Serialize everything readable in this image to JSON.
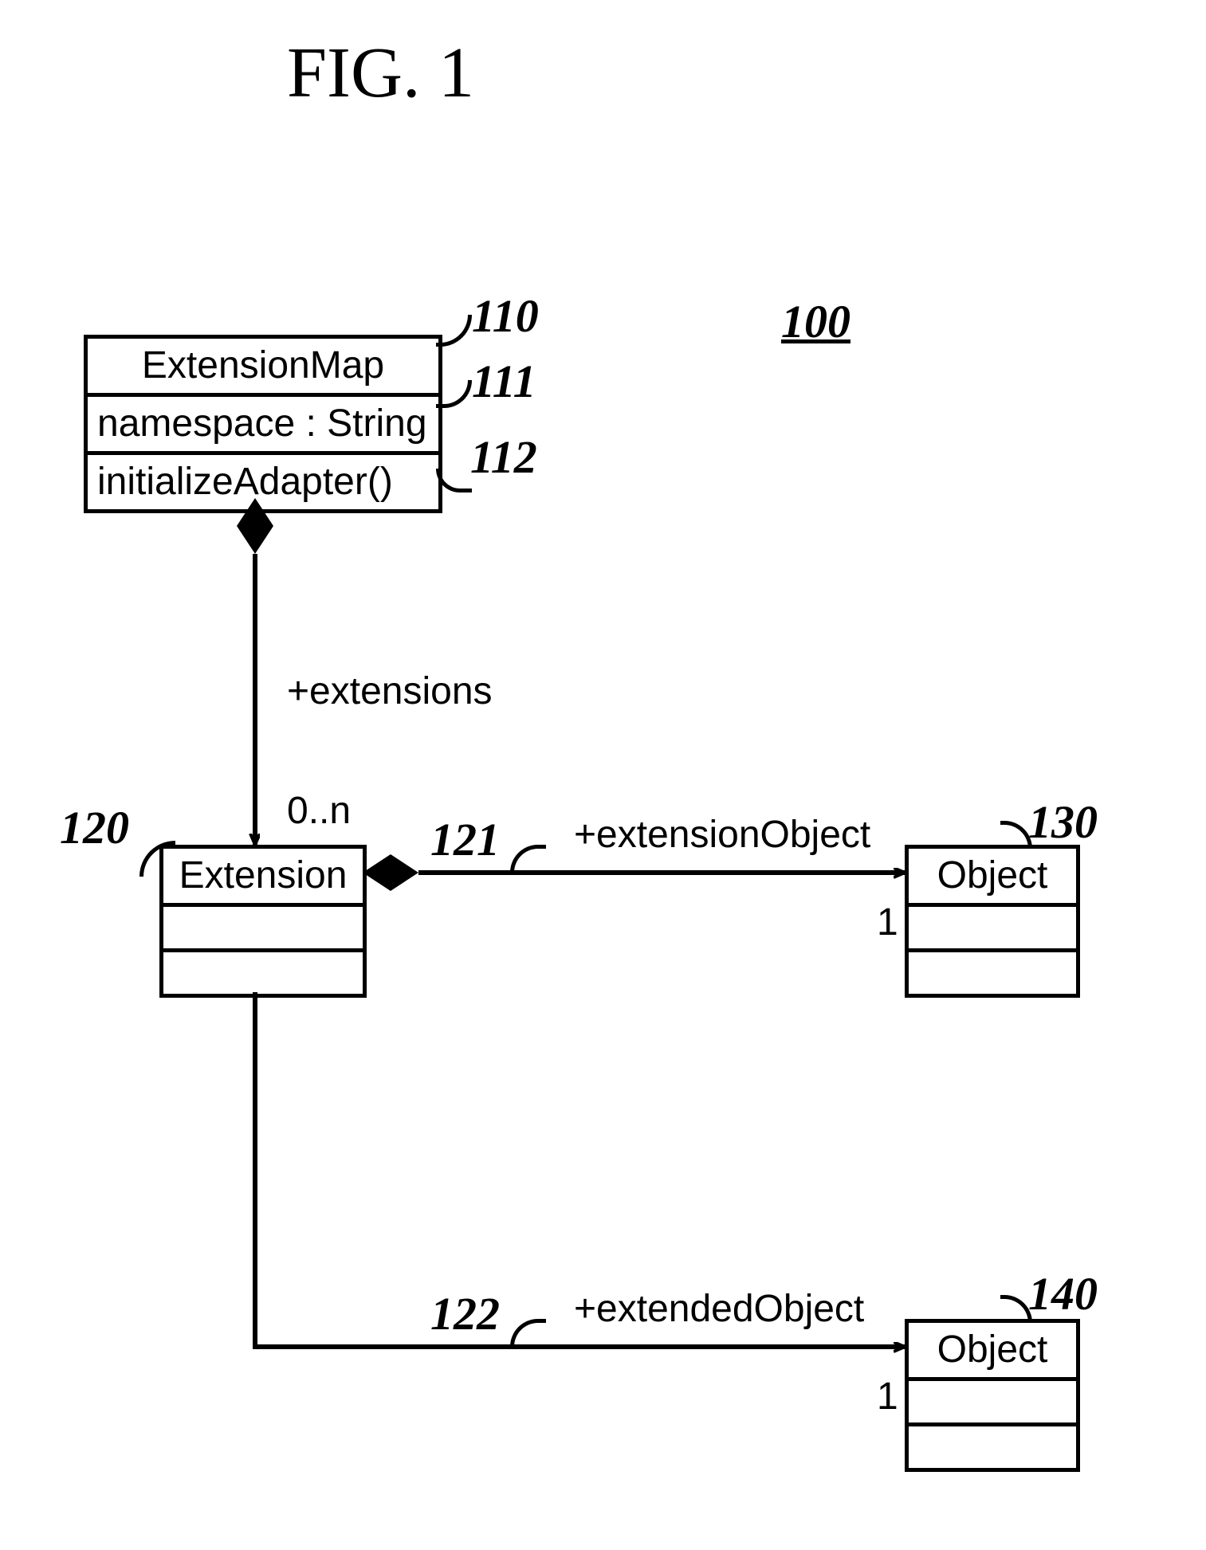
{
  "figure": {
    "title": "FIG. 1",
    "diagram_id": "100"
  },
  "classes": {
    "extensionMap": {
      "ref": "110",
      "name": "ExtensionMap",
      "attr_ref": "111",
      "attribute": "namespace : String",
      "op_ref": "112",
      "operation": "initializeAdapter()"
    },
    "extension": {
      "ref": "120",
      "name": "Extension"
    },
    "object1": {
      "ref": "130",
      "name": "Object"
    },
    "object2": {
      "ref": "140",
      "name": "Object"
    }
  },
  "associations": {
    "extensions": {
      "role": "+extensions",
      "multiplicity": "0..n"
    },
    "extensionObject": {
      "ref": "121",
      "role": "+extensionObject",
      "multiplicity": "1"
    },
    "extendedObject": {
      "ref": "122",
      "role": "+extendedObject",
      "multiplicity": "1"
    }
  }
}
